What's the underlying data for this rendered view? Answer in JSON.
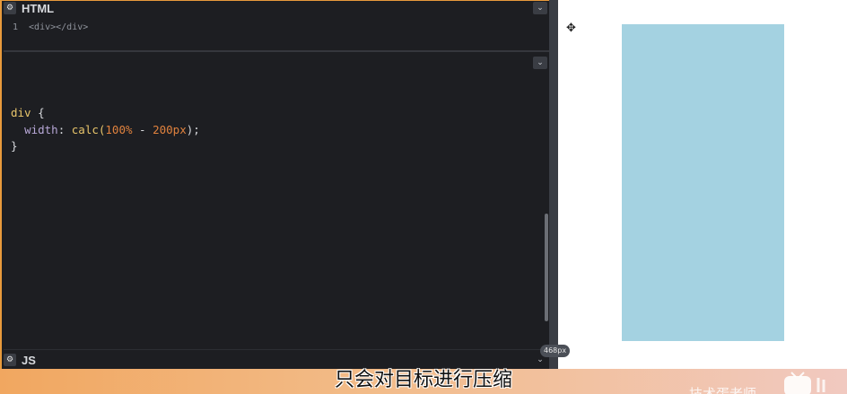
{
  "html_panel": {
    "title": "HTML",
    "line_number": "1",
    "code": "<div></div>"
  },
  "css_panel": {
    "line1_selector": "div",
    "line1_brace": " {",
    "line2_indent": "  ",
    "line2_prop": "width",
    "line2_colon": ": ",
    "line2_fn": "calc(",
    "line2_num1": "100%",
    "line2_op": " - ",
    "line2_num2": "200px",
    "line2_end": ");",
    "line3": "}"
  },
  "js_panel": {
    "title": "JS"
  },
  "preview": {
    "width_badge": "468px",
    "box_color": "#a4d2e1"
  },
  "subtitle": "只会对目标进行压缩",
  "watermark": "技术蛋老师",
  "colors": {
    "accent": "#e89a3c",
    "editor_bg": "#1d1e22"
  }
}
